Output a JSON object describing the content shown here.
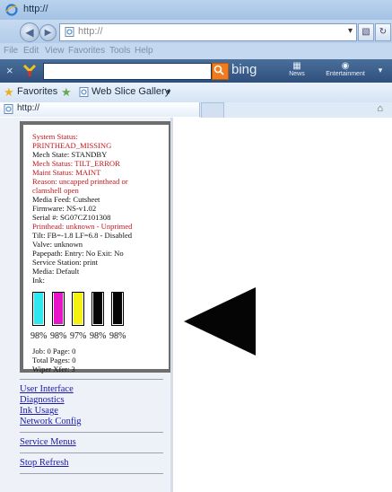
{
  "window": {
    "title": "http://"
  },
  "address_bar": {
    "url": "http://"
  },
  "menu": {
    "items": [
      "File",
      "Edit",
      "View",
      "Favorites",
      "Tools",
      "Help"
    ]
  },
  "search_toolbar": {
    "engine": "bing",
    "news_label": "News",
    "entertainment_label": "Entertainment",
    "search_value": ""
  },
  "favorites_bar": {
    "favorites_label": "Favorites",
    "web_slice_label": "Web Slice Gallery"
  },
  "tab": {
    "label": "http://"
  },
  "status_panel": {
    "lines": [
      {
        "text": "System Status:",
        "color": "red"
      },
      {
        "text": "PRINTHEAD_MISSING",
        "color": "red"
      },
      {
        "text": "Mech State: STANDBY",
        "color": "black"
      },
      {
        "text": "Mech Status: TILT_ERROR",
        "color": "red"
      },
      {
        "text": "Maint Status: MAINT",
        "color": "red"
      },
      {
        "text": "Reason: uncapped printhead or",
        "color": "red"
      },
      {
        "text": "clamshell open",
        "color": "red"
      },
      {
        "text": "Media Feed: Cutsheet",
        "color": "black"
      },
      {
        "text": "Firmware: NS-v1.02",
        "color": "black"
      },
      {
        "text": "Serial #: SG07CZ101308",
        "color": "black"
      },
      {
        "text": "Printhead: unknown - Unprimed",
        "color": "red"
      },
      {
        "text": "Tilt: FB=-1.8 LF=6.8 - Disabled",
        "color": "black"
      },
      {
        "text": "Valve: unknown",
        "color": "black"
      },
      {
        "text": "Papepath: Entry: No Exit: No",
        "color": "black"
      },
      {
        "text": "Service Station: print",
        "color": "black"
      },
      {
        "text": "Media: Default",
        "color": "black"
      },
      {
        "text": "Ink:",
        "color": "black"
      }
    ],
    "ink": [
      {
        "color": "#2ee8f0",
        "level_percent": 98,
        "label": "98%"
      },
      {
        "color": "#e815c8",
        "level_percent": 98,
        "label": "98%"
      },
      {
        "color": "#f4f010",
        "level_percent": 97,
        "label": "97%"
      },
      {
        "color": "#050505",
        "level_percent": 98,
        "label": "98%"
      },
      {
        "color": "#050505",
        "level_percent": 98,
        "label": "98%"
      }
    ],
    "bottom_lines": [
      "Job: 0 Page: 0",
      "Total Pages: 0",
      "Wiper Xfer: 3"
    ]
  },
  "nav_links": {
    "group1": [
      "User Interface",
      "Diagnostics",
      "Ink Usage",
      "Network Config"
    ],
    "group2": [
      "Service Menus"
    ],
    "group3": [
      "Stop Refresh"
    ]
  },
  "colors": {
    "error_text": "#c8141c",
    "link": "#1a1aa8",
    "panel_border": "#6e6e6e",
    "arrow": "#050505"
  }
}
